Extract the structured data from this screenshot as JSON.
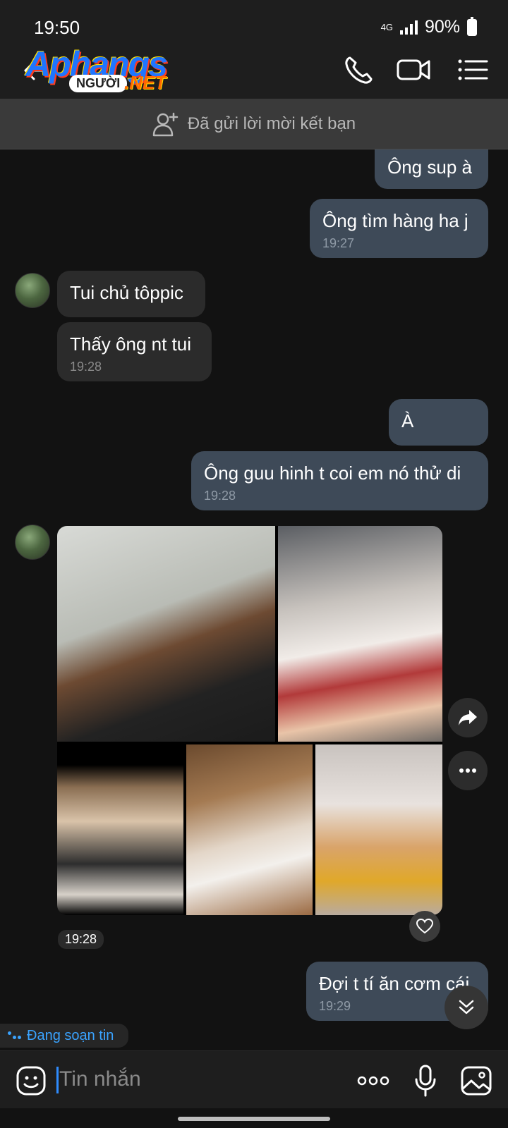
{
  "status_bar": {
    "time": "19:50",
    "network": "4G",
    "battery": "90%"
  },
  "header": {
    "logo_main": "Aphangs",
    "logo_sub": "NGƯỜI",
    "logo_net": ".NET",
    "icons": [
      "back-arrow-icon",
      "phone-icon",
      "video-call-icon",
      "menu-list-icon"
    ]
  },
  "friend_request": {
    "text": "Đã gửi lời mời kết bạn",
    "icon": "add-person-icon"
  },
  "messages": [
    {
      "dir": "out",
      "text": "Ông sup à",
      "time": ""
    },
    {
      "dir": "out",
      "text": "Ông tìm hàng ha j",
      "time": "19:27"
    },
    {
      "dir": "in",
      "text": "Tui chủ tôppic",
      "time": ""
    },
    {
      "dir": "in",
      "text": "Thấy ông nt tui",
      "time": "19:28"
    },
    {
      "dir": "out",
      "text": "À",
      "time": ""
    },
    {
      "dir": "out",
      "text": "Ông guu hinh t coi em nó thử di",
      "time": "19:28"
    },
    {
      "dir": "in",
      "type": "photo_gallery",
      "photo_count": 5,
      "time": "19:28"
    },
    {
      "dir": "out",
      "text": "Đợi t tí ăn cơm cái",
      "time": "19:29"
    }
  ],
  "typing_indicator": "Đang soạn tin",
  "input": {
    "placeholder": "Tin nhắn"
  },
  "colors": {
    "background": "#121212",
    "bubble_out": "#3e4a58",
    "bubble_in": "#2b2b2b",
    "accent": "#2f8cff"
  }
}
